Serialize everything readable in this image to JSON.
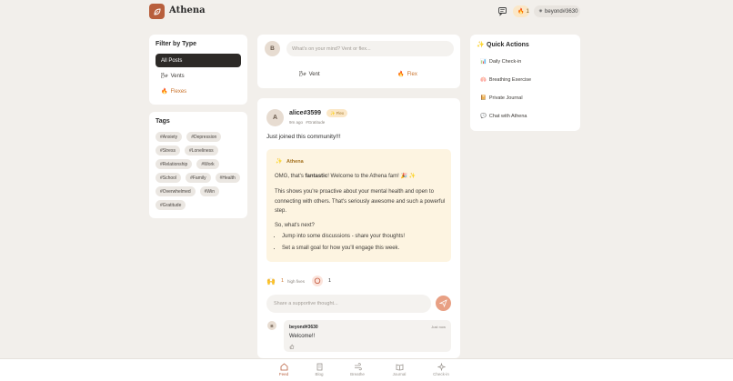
{
  "app": {
    "name": "Athena"
  },
  "header": {
    "flame_count": "1",
    "username": "beyond#3630"
  },
  "filter": {
    "title": "Filter by Type",
    "items": [
      {
        "label": "All Posts",
        "active": true
      },
      {
        "label": "Vents",
        "active": false
      },
      {
        "label": "Flexes",
        "active": false
      }
    ]
  },
  "tags": {
    "title": "Tags",
    "items": [
      "#Anxiety",
      "#Depression",
      "#Stress",
      "#Loneliness",
      "#Relationship",
      "#Work",
      "#School",
      "#Family",
      "#Health",
      "#Overwhelmed",
      "#Win",
      "#Gratitude"
    ]
  },
  "composer": {
    "avatar_initial": "B",
    "placeholder": "What's on your mind? Vent or flex...",
    "vent_label": "Vent",
    "flex_label": "Flex"
  },
  "post": {
    "avatar_initial": "A",
    "username": "alice#3599",
    "badge": "Flex",
    "time": "9m ago",
    "tag": "#Gratitude",
    "body": "Just joined this community!!!",
    "ai": {
      "name": "Athena",
      "line1_pre": "OMG, that's ",
      "line1_bold": "fantastic",
      "line1_post": "! Welcome to the Athena fam! 🎉 ✨",
      "para2": "This shows you're proactive about your mental health and open to connecting with others. That's seriously awesome and such a powerful step.",
      "para3": "So, what's next?",
      "bullets": [
        "Jump into some discussions - share your thoughts!",
        "Set a small goal for how you'll engage this week."
      ]
    },
    "reactions": {
      "high_fives_count": "1",
      "high_fives_label": "high fives",
      "comments_count": "1"
    },
    "reply_placeholder": "Share a supportive thought...",
    "comment": {
      "avatar_initial": "B",
      "username": "beyond#3630",
      "time": "Just now",
      "text": "Welcome!!"
    }
  },
  "quick_actions": {
    "title": "Quick Actions",
    "items": [
      {
        "label": "Daily Check-in",
        "icon": "📊"
      },
      {
        "label": "Breathing Exercise",
        "icon": "🫁"
      },
      {
        "label": "Private Journal",
        "icon": "📔"
      },
      {
        "label": "Chat with Athena",
        "icon": "💬"
      }
    ]
  },
  "nav": {
    "items": [
      {
        "label": "Feed",
        "active": true
      },
      {
        "label": "Blog",
        "active": false
      },
      {
        "label": "Breathe",
        "active": false
      },
      {
        "label": "Journal",
        "active": false
      },
      {
        "label": "Check-in",
        "active": false
      }
    ]
  },
  "colors": {
    "accent": "#b85f3d",
    "background": "#f2efeb",
    "ai_box": "#fdf4e1"
  }
}
